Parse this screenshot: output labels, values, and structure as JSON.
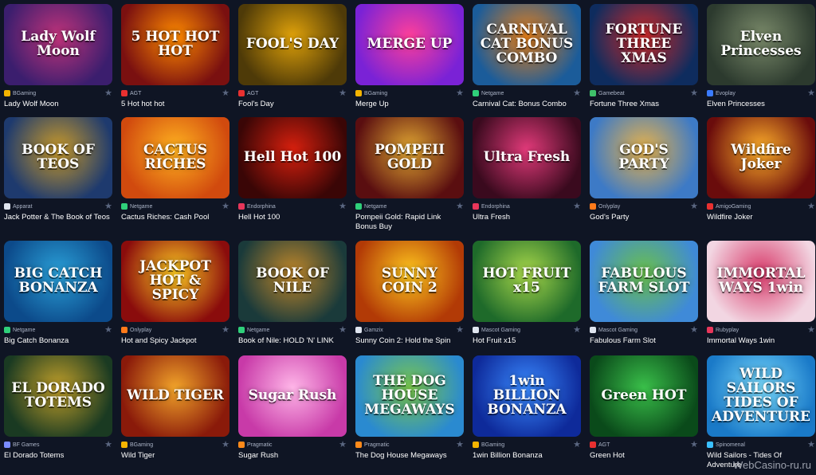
{
  "games": [
    {
      "name": "Lady Wolf Moon",
      "provider": "BGaming",
      "art_title": "Lady Wolf Moon",
      "icon": "bgaming-logo-icon",
      "colors": [
        "#3b1e6e",
        "#c0337a"
      ],
      "icon_color": "#f5b400"
    },
    {
      "name": "5 Hot hot hot",
      "provider": "AGT",
      "art_title": "5 HOT HOT HOT",
      "icon": "agt-logo-icon",
      "colors": [
        "#7a1010",
        "#ff8a00"
      ],
      "icon_color": "#e83030"
    },
    {
      "name": "Fool's Day",
      "provider": "AGT",
      "art_title": "FOOL'S DAY",
      "icon": "agt-logo-icon",
      "colors": [
        "#4e3a08",
        "#e0a20a"
      ],
      "icon_color": "#e83030"
    },
    {
      "name": "Merge Up",
      "provider": "BGaming",
      "art_title": "MERGE UP",
      "icon": "bgaming-logo-icon",
      "colors": [
        "#7a22d6",
        "#ff3f9a"
      ],
      "icon_color": "#f5b400"
    },
    {
      "name": "Carnival Cat: Bonus Combo",
      "provider": "Netgame",
      "art_title": "CARNIVAL CAT BONUS COMBO",
      "icon": "netgame-logo-icon",
      "colors": [
        "#1b5c9a",
        "#e67f1a"
      ],
      "icon_color": "#2fd07a"
    },
    {
      "name": "Fortune Three Xmas",
      "provider": "Gamebeat",
      "art_title": "FORTUNE THREE XMAS",
      "icon": "gamebeat-logo-icon",
      "colors": [
        "#0e2c5e",
        "#d12a2a"
      ],
      "icon_color": "#3fc06a"
    },
    {
      "name": "Elven Princesses",
      "provider": "Evoplay",
      "art_title": "Elven Princesses",
      "icon": "evoplay-logo-icon",
      "colors": [
        "#2c3a2e",
        "#7a8a6a"
      ],
      "icon_color": "#3a7bff"
    },
    {
      "name": "Jack Potter & The Book of Teos",
      "provider": "Apparat",
      "art_title": "BOOK OF TEOS",
      "icon": "apparat-logo-icon",
      "colors": [
        "#1e3a6e",
        "#c99a2a"
      ],
      "icon_color": "#dfe5ef"
    },
    {
      "name": "Cactus Riches: Cash Pool",
      "provider": "Netgame",
      "art_title": "CACTUS RICHES",
      "icon": "netgame-logo-icon",
      "colors": [
        "#d14a0e",
        "#ffb320"
      ],
      "icon_color": "#2fd07a"
    },
    {
      "name": "Hell Hot 100",
      "provider": "Endorphina",
      "art_title": "Hell Hot 100",
      "icon": "endorphina-logo-icon",
      "colors": [
        "#3a0606",
        "#d8200e"
      ],
      "icon_color": "#e8365a"
    },
    {
      "name": "Pompeii Gold: Rapid Link Bonus Buy",
      "provider": "Netgame",
      "art_title": "POMPEII GOLD",
      "icon": "netgame-logo-icon",
      "colors": [
        "#5a0e10",
        "#e2a832"
      ],
      "icon_color": "#2fd07a"
    },
    {
      "name": "Ultra Fresh",
      "provider": "Endorphina",
      "art_title": "Ultra Fresh",
      "icon": "endorphina-logo-icon",
      "colors": [
        "#3a0a1e",
        "#e23a7a"
      ],
      "icon_color": "#e8365a"
    },
    {
      "name": "God's Party",
      "provider": "Onlyplay",
      "art_title": "GOD'S PARTY",
      "icon": "onlyplay-logo-icon",
      "colors": [
        "#3d7ac6",
        "#e8b24a"
      ],
      "icon_color": "#ff7a1a"
    },
    {
      "name": "Wildfire Joker",
      "provider": "AmigoGaming",
      "art_title": "Wildfire Joker",
      "icon": "amigogaming-logo-icon",
      "colors": [
        "#6a0c0c",
        "#ffb02a"
      ],
      "icon_color": "#e83030"
    },
    {
      "name": "Big Catch Bonanza",
      "provider": "Netgame",
      "art_title": "BIG CATCH BONANZA",
      "icon": "netgame-logo-icon",
      "colors": [
        "#0c4a8a",
        "#2aa0d8"
      ],
      "icon_color": "#2fd07a"
    },
    {
      "name": "Hot and Spicy Jackpot",
      "provider": "Onlyplay",
      "art_title": "JACKPOT HOT & SPICY",
      "icon": "onlyplay-logo-icon",
      "colors": [
        "#8a0c0c",
        "#ffcc22"
      ],
      "icon_color": "#ff7a1a"
    },
    {
      "name": "Book of Nile: HOLD 'N' LINK",
      "provider": "Netgame",
      "art_title": "BOOK OF NILE",
      "icon": "netgame-logo-icon",
      "colors": [
        "#1a3a3a",
        "#c2882a"
      ],
      "icon_color": "#2fd07a"
    },
    {
      "name": "Sunny Coin 2: Hold the Spin",
      "provider": "Gamzix",
      "art_title": "SUNNY COIN 2",
      "icon": "gamzix-logo-icon",
      "colors": [
        "#b23a06",
        "#ffc81e"
      ],
      "icon_color": "#dfe5ef"
    },
    {
      "name": "Hot Fruit x15",
      "provider": "Mascot Gaming",
      "art_title": "HOT FRUIT x15",
      "icon": "mascot-logo-icon",
      "colors": [
        "#1e6a2a",
        "#a8d84a"
      ],
      "icon_color": "#dfe5ef"
    },
    {
      "name": "Fabulous Farm Slot",
      "provider": "Mascot Gaming",
      "art_title": "FABULOUS FARM SLOT",
      "icon": "mascot-logo-icon",
      "colors": [
        "#3f8ad8",
        "#6ac04a"
      ],
      "icon_color": "#dfe5ef"
    },
    {
      "name": "Immortal Ways 1win",
      "provider": "Rubyplay",
      "art_title": "IMMORTAL WAYS 1win",
      "icon": "rubyplay-logo-icon",
      "colors": [
        "#f2d6e2",
        "#d83a6a"
      ],
      "icon_color": "#e8365a"
    },
    {
      "name": "El Dorado Totems",
      "provider": "BF Games",
      "art_title": "EL DORADO TOTEMS",
      "icon": "bfgames-logo-icon",
      "colors": [
        "#1a3a22",
        "#c2a02a"
      ],
      "icon_color": "#7a8cff"
    },
    {
      "name": "Wild Tiger",
      "provider": "BGaming",
      "art_title": "WILD TIGER",
      "icon": "bgaming-logo-icon",
      "colors": [
        "#8a1a0a",
        "#f2a42a"
      ],
      "icon_color": "#f5b400"
    },
    {
      "name": "Sugar Rush",
      "provider": "Pragmatic",
      "art_title": "Sugar Rush",
      "icon": "pragmatic-logo-icon",
      "colors": [
        "#c83aa8",
        "#ffb6e8"
      ],
      "icon_color": "#ff8a1a"
    },
    {
      "name": "The Dog House Megaways",
      "provider": "Pragmatic",
      "art_title": "THE DOG HOUSE MEGAWAYS",
      "icon": "pragmatic-logo-icon",
      "colors": [
        "#2a8ad0",
        "#7ac84a"
      ],
      "icon_color": "#ff8a1a"
    },
    {
      "name": "1win Billion Bonanza",
      "provider": "BGaming",
      "art_title": "1win BILLION BONANZA",
      "icon": "bgaming-logo-icon",
      "colors": [
        "#0e2a9a",
        "#3a8aff"
      ],
      "icon_color": "#f5b400"
    },
    {
      "name": "Green Hot",
      "provider": "AGT",
      "art_title": "Green HOT",
      "icon": "agt-logo-icon",
      "colors": [
        "#0a4a1a",
        "#3ac04a"
      ],
      "icon_color": "#e83030"
    },
    {
      "name": "Wild Sailors - Tides Of Adventure",
      "provider": "Spinomenal",
      "art_title": "WILD SAILORS TIDES OF ADVENTURE",
      "icon": "spinomenal-logo-icon",
      "colors": [
        "#1a7ac8",
        "#7adcff"
      ],
      "icon_color": "#3ac0ff"
    }
  ],
  "favorite_glyph": "★",
  "watermark": "WebCasino-ru.ru"
}
